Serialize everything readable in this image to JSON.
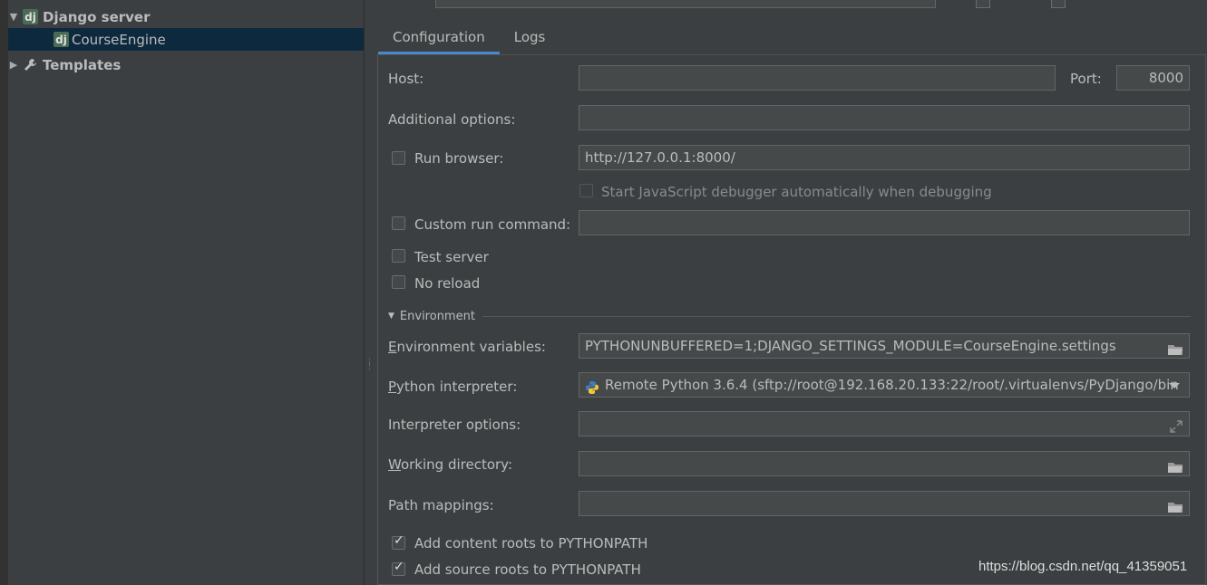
{
  "tree": {
    "django_server_label": "Django server",
    "course_engine_label": "CourseEngine",
    "templates_label": "Templates",
    "dj_badge": "dj"
  },
  "tabs": [
    "Configuration",
    "Logs"
  ],
  "form": {
    "host_label": "Host:",
    "host_value": "",
    "port_label": "Port:",
    "port_value": "8000",
    "additional_label": "Additional options:",
    "additional_value": "",
    "run_browser_label": "Run browser:",
    "run_browser_url": "http://127.0.0.1:8000/",
    "js_debugger_label": "Start JavaScript debugger automatically when debugging",
    "custom_cmd_label": "Custom run command:",
    "custom_cmd_value": "",
    "test_server_label": "Test server",
    "no_reload_label": "No reload",
    "environment_section": "Environment",
    "env_vars_label_first": "E",
    "env_vars_label_rest": "nvironment variables:",
    "env_vars_value": "PYTHONUNBUFFERED=1;DJANGO_SETTINGS_MODULE=CourseEngine.settings",
    "interpreter_label_first": "P",
    "interpreter_label_rest": "ython interpreter:",
    "interpreter_value": "Remote Python 3.6.4 (sftp://root@192.168.20.133:22/root/.virtualenvs/PyDjango/bin",
    "interp_options_label": "Interpreter options:",
    "interp_options_value": "",
    "workdir_label_first": "W",
    "workdir_label_rest": "orking directory:",
    "workdir_value": "",
    "path_mappings_label": "Path mappings:",
    "path_mappings_value": "",
    "content_roots_label": "Add content roots to PYTHONPATH",
    "source_roots_label": "Add source roots to PYTHONPATH"
  },
  "checkboxes": {
    "run_browser": false,
    "js_debugger": false,
    "custom_cmd": false,
    "test_server": false,
    "no_reload": false,
    "content_roots": true,
    "source_roots": true
  },
  "watermark": "https://blog.csdn.net/qq_41359051",
  "colors": {
    "background": "#3c3f41",
    "field": "#45494a",
    "selection": "#0d293e",
    "tab_accent": "#4a88c7",
    "dj_badge": "#4a6b55"
  },
  "icons": [
    "folder-icon",
    "python-icon",
    "wrench-icon",
    "expand-icon",
    "chevron-down-icon"
  ]
}
